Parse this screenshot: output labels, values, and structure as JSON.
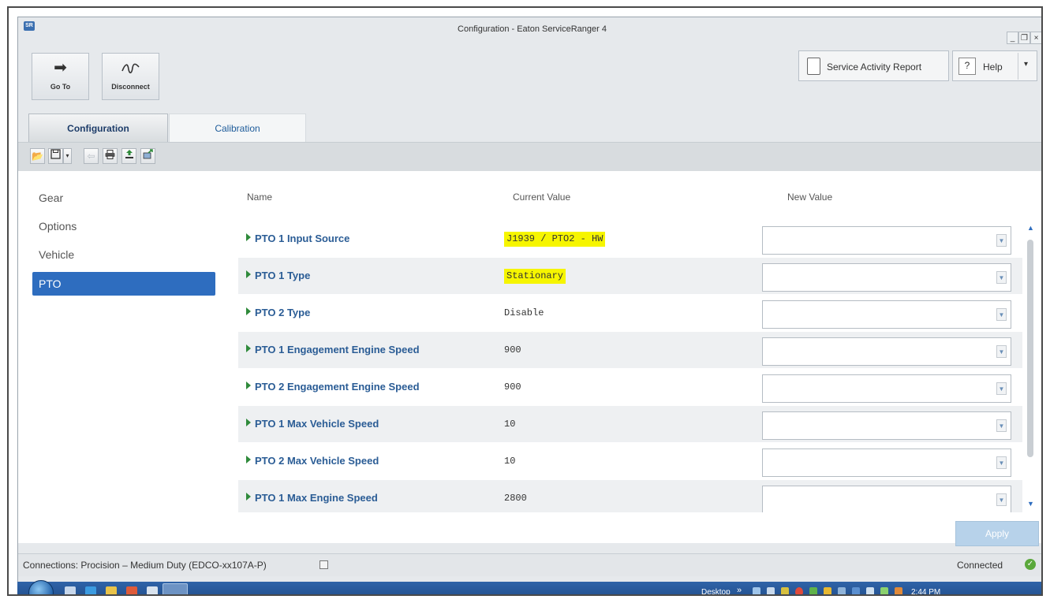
{
  "window": {
    "app_icon": "SR",
    "title": "Configuration - Eaton ServiceRanger 4",
    "controls": [
      "_",
      "❐",
      "×"
    ]
  },
  "toolbar": {
    "goto_label": "Go To",
    "disconnect_label": "Disconnect",
    "service_activity_label": "Service Activity Report",
    "help_label": "Help",
    "help_icon": "?"
  },
  "tabs": [
    {
      "label": "Configuration",
      "active": true
    },
    {
      "label": "Calibration",
      "active": false
    }
  ],
  "icon_toolbar": [
    "open-folder-icon",
    "save-icon",
    "dropdown-icon",
    "undo-icon",
    "print-icon",
    "upload-icon",
    "export-icon"
  ],
  "sidebar": {
    "items": [
      {
        "label": "Gear"
      },
      {
        "label": "Options"
      },
      {
        "label": "Vehicle"
      },
      {
        "label": "PTO",
        "selected": true
      }
    ]
  },
  "table": {
    "headers": [
      "Name",
      "Current Value",
      "New Value"
    ],
    "rows": [
      {
        "name": "PTO 1 Input Source",
        "current": "J1939 / PTO2 - HW",
        "highlight": true
      },
      {
        "name": "PTO 1 Type",
        "current": "Stationary",
        "highlight": true
      },
      {
        "name": "PTO 2 Type",
        "current": "Disable",
        "highlight": false
      },
      {
        "name": "PTO 1 Engagement Engine Speed",
        "current": "900",
        "highlight": false
      },
      {
        "name": "PTO 2 Engagement Engine Speed",
        "current": "900",
        "highlight": false
      },
      {
        "name": "PTO 1 Max Vehicle Speed",
        "current": "10",
        "highlight": false
      },
      {
        "name": "PTO 2 Max Vehicle Speed",
        "current": "10",
        "highlight": false
      },
      {
        "name": "PTO 1 Max Engine Speed",
        "current": "2800",
        "highlight": false
      }
    ]
  },
  "apply_label": "Apply",
  "status": {
    "connection": "Connections: Procision – Medium Duty (EDCO-xx107A-P)",
    "state": "Connected"
  },
  "taskbar": {
    "desktop_label": "Desktop",
    "time": "2:44 PM"
  },
  "colors": {
    "accent": "#2e6dbf",
    "highlight": "#f6f500",
    "row_name": "#2a5c95"
  }
}
